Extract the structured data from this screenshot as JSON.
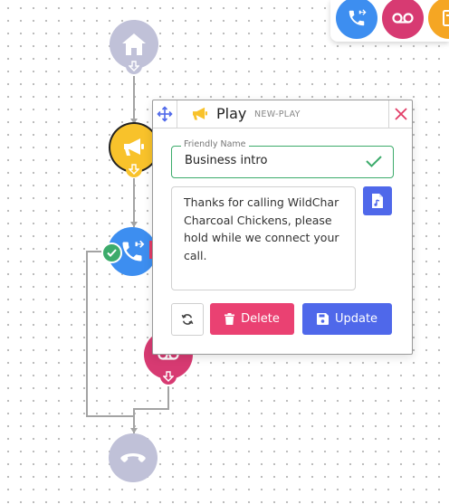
{
  "palette": {
    "items": [
      {
        "icon": "phone-transfer-icon"
      },
      {
        "icon": "voicemail-icon"
      },
      {
        "icon": "document-icon"
      }
    ]
  },
  "flow": {
    "nodes": [
      {
        "type": "start",
        "icon": "home-icon",
        "color": "#c0c1d8"
      },
      {
        "type": "play",
        "icon": "megaphone-icon",
        "color": "#f8c22b"
      },
      {
        "type": "transfer",
        "icon": "phone-transfer-icon",
        "color": "#3d8ef0"
      },
      {
        "type": "voicemail",
        "icon": "voicemail-icon",
        "color": "#d73a72"
      },
      {
        "type": "end",
        "icon": "hang-up-icon",
        "color": "#c0c1d8"
      }
    ]
  },
  "panel": {
    "title": "Play",
    "subtitle": "NEW-PLAY",
    "friendly_name_label": "Friendly Name",
    "friendly_name_value": "Business intro",
    "message": "Thanks for calling WildChar Charcoal Chickens, please hold while we connect your call.",
    "delete_label": "Delete",
    "update_label": "Update",
    "colors": {
      "delete": "#ea4172",
      "update": "#4f68ea",
      "valid": "#3cab6b"
    }
  }
}
